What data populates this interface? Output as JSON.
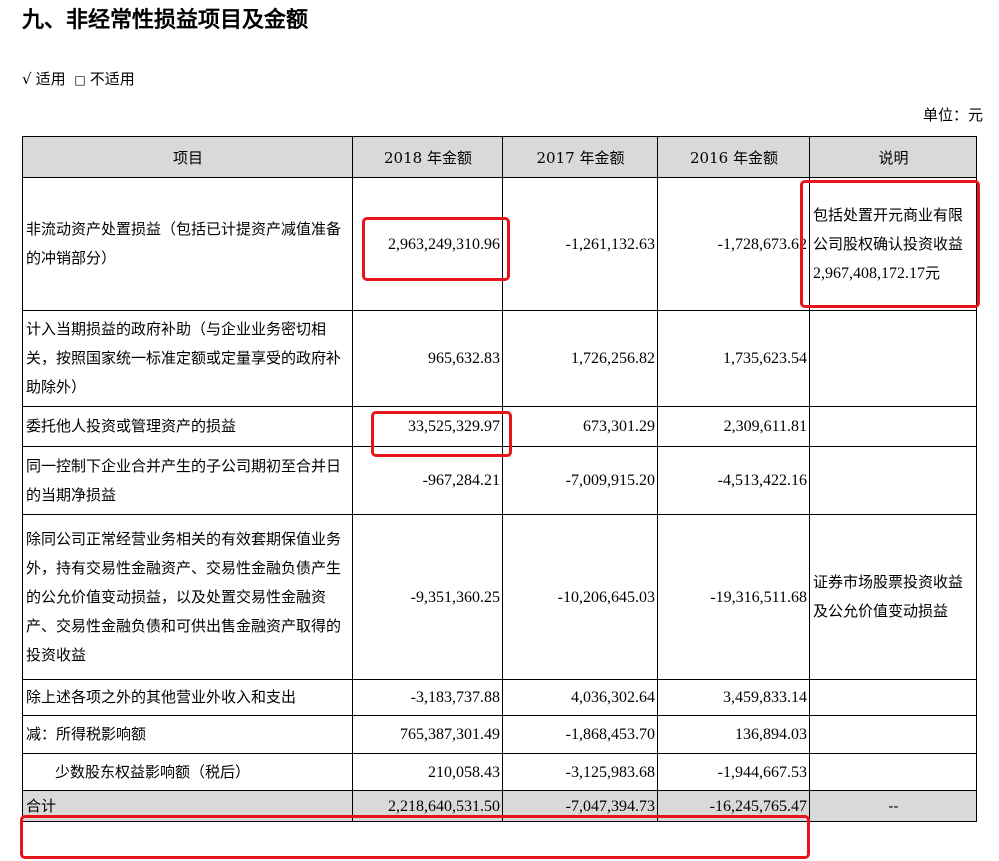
{
  "section_title": "九、非经常性损益项目及金额",
  "applicability": {
    "applicable_mark": "√",
    "applicable_label": "适用",
    "not_applicable_mark": "□",
    "not_applicable_label": "不适用"
  },
  "unit": "单位：元",
  "table": {
    "headers": [
      "项目",
      "2018 年金额",
      "2017 年金额",
      "2016 年金额",
      "说明"
    ],
    "rows": [
      {
        "item": "非流动资产处置损益（包括已计提资产减值准备的冲销部分）",
        "y2018": "2,963,249,310.96",
        "y2017": "-1,261,132.63",
        "y2016": "-1,728,673.62",
        "note": "包括处置开元商业有限公司股权确认投资收益",
        "note_amount": "2,967,408,172.17",
        "note_suffix": "元"
      },
      {
        "item": "计入当期损益的政府补助（与企业业务密切相关，按照国家统一标准定额或定量享受的政府补助除外）",
        "y2018": "965,632.83",
        "y2017": "1,726,256.82",
        "y2016": "1,735,623.54",
        "note": ""
      },
      {
        "item": "委托他人投资或管理资产的损益",
        "y2018": "33,525,329.97",
        "y2017": "673,301.29",
        "y2016": "2,309,611.81",
        "note": ""
      },
      {
        "item": "同一控制下企业合并产生的子公司期初至合并日的当期净损益",
        "y2018": "-967,284.21",
        "y2017": "-7,009,915.20",
        "y2016": "-4,513,422.16",
        "note": ""
      },
      {
        "item": "除同公司正常经营业务相关的有效套期保值业务外，持有交易性金融资产、交易性金融负债产生的公允价值变动损益，以及处置交易性金融资产、交易性金融负债和可供出售金融资产取得的投资收益",
        "y2018": "-9,351,360.25",
        "y2017": "-10,206,645.03",
        "y2016": "-19,316,511.68",
        "note": "证券市场股票投资收益及公允价值变动损益"
      },
      {
        "item": "除上述各项之外的其他营业外收入和支出",
        "y2018": "-3,183,737.88",
        "y2017": "4,036,302.64",
        "y2016": "3,459,833.14",
        "note": ""
      },
      {
        "item": "减：所得税影响额",
        "y2018": "765,387,301.49",
        "y2017": "-1,868,453.70",
        "y2016": "136,894.03",
        "note": ""
      },
      {
        "item": "少数股东权益影响额（税后）",
        "y2018": "210,058.43",
        "y2017": "-3,125,983.68",
        "y2016": "-1,944,667.53",
        "note": ""
      }
    ],
    "total": {
      "item": "合计",
      "y2018": "2,218,640,531.50",
      "y2017": "-7,047,394.73",
      "y2016": "-16,245,765.47",
      "note": "--"
    }
  },
  "highlight_color": "#e8141c"
}
